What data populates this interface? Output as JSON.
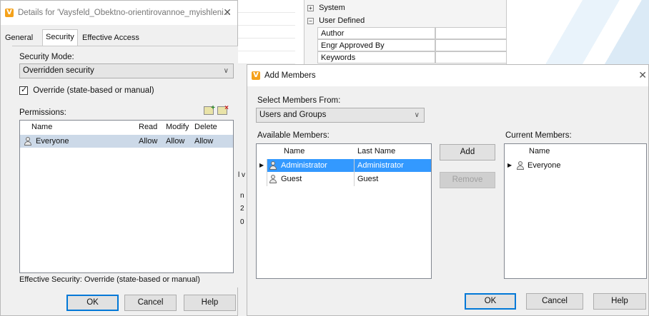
{
  "details": {
    "title": "Details for 'Vaysfeld_Obektno-orientirovannoe_myishleni...",
    "tabs": [
      "General",
      "Security",
      "Effective Access"
    ],
    "security_mode_label": "Security Mode:",
    "security_mode_value": "Overridden security",
    "override_label": "Override (state-based or manual)",
    "override_checked": true,
    "permissions_label": "Permissions:",
    "columns": [
      "Name",
      "Read",
      "Modify",
      "Delete"
    ],
    "rows": [
      {
        "name": "Everyone",
        "read": "Allow",
        "modify": "Allow",
        "delete": "Allow"
      }
    ],
    "effective_security": "Effective Security: Override (state-based or manual)",
    "ok": "OK",
    "cancel": "Cancel",
    "help": "Help"
  },
  "background": {
    "tree": [
      "System",
      "User Defined"
    ],
    "properties": [
      "Author",
      "Engr Approved By",
      "Keywords"
    ],
    "partial_text": [
      "l v",
      "n",
      "2",
      "0"
    ]
  },
  "add_members": {
    "title": "Add Members",
    "select_from_label": "Select Members From:",
    "select_from_value": "Users and Groups",
    "available_label": "Available Members:",
    "available_columns": [
      "Name",
      "Last Name"
    ],
    "available_rows": [
      {
        "name": "Administrator",
        "last_name": "Administrator",
        "selected": true
      },
      {
        "name": "Guest",
        "last_name": "Guest",
        "selected": false
      }
    ],
    "add": "Add",
    "remove": "Remove",
    "current_label": "Current Members:",
    "current_column": "Name",
    "current_rows": [
      "Everyone"
    ],
    "ok": "OK",
    "cancel": "Cancel",
    "help": "Help"
  },
  "colors": {
    "accent": "#0078d7",
    "row_selected": "#cce8ff",
    "row_highlight": "#3399ff",
    "brand": "#f5a21b"
  }
}
